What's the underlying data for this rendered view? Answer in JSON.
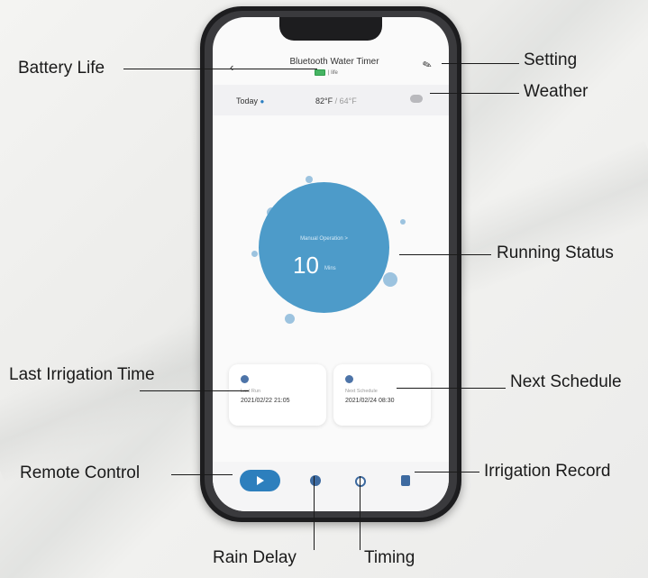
{
  "app": {
    "title": "Bluetooth Water Timer",
    "battery_text": "| life",
    "back_icon": "back-chevron-icon",
    "edit_icon": "edit-pencil-icon"
  },
  "weather": {
    "day": "Today",
    "high": "82°F",
    "separator": " / ",
    "low": "64°F"
  },
  "status": {
    "label": "Manual Operation >",
    "value": "10",
    "unit": "Mins"
  },
  "cards": {
    "last_run": {
      "label": "Last Run",
      "value": "2021/02/22 21:05"
    },
    "next_schedule": {
      "label": "Next Schedule",
      "value": "2021/02/24 08:30"
    }
  },
  "callouts": {
    "battery_life": "Battery Life",
    "setting": "Setting",
    "weather": "Weather",
    "running_status": "Running Status",
    "last_irrigation_time": "Last Irrigation Time",
    "next_schedule": "Next Schedule",
    "remote_control": "Remote Control",
    "irrigation_record": "Irrigation Record",
    "rain_delay": "Rain Delay",
    "timing": "Timing"
  },
  "colors": {
    "accent": "#4d9bc9",
    "primary": "#2d7fbd",
    "icon": "#3d6aa0"
  }
}
